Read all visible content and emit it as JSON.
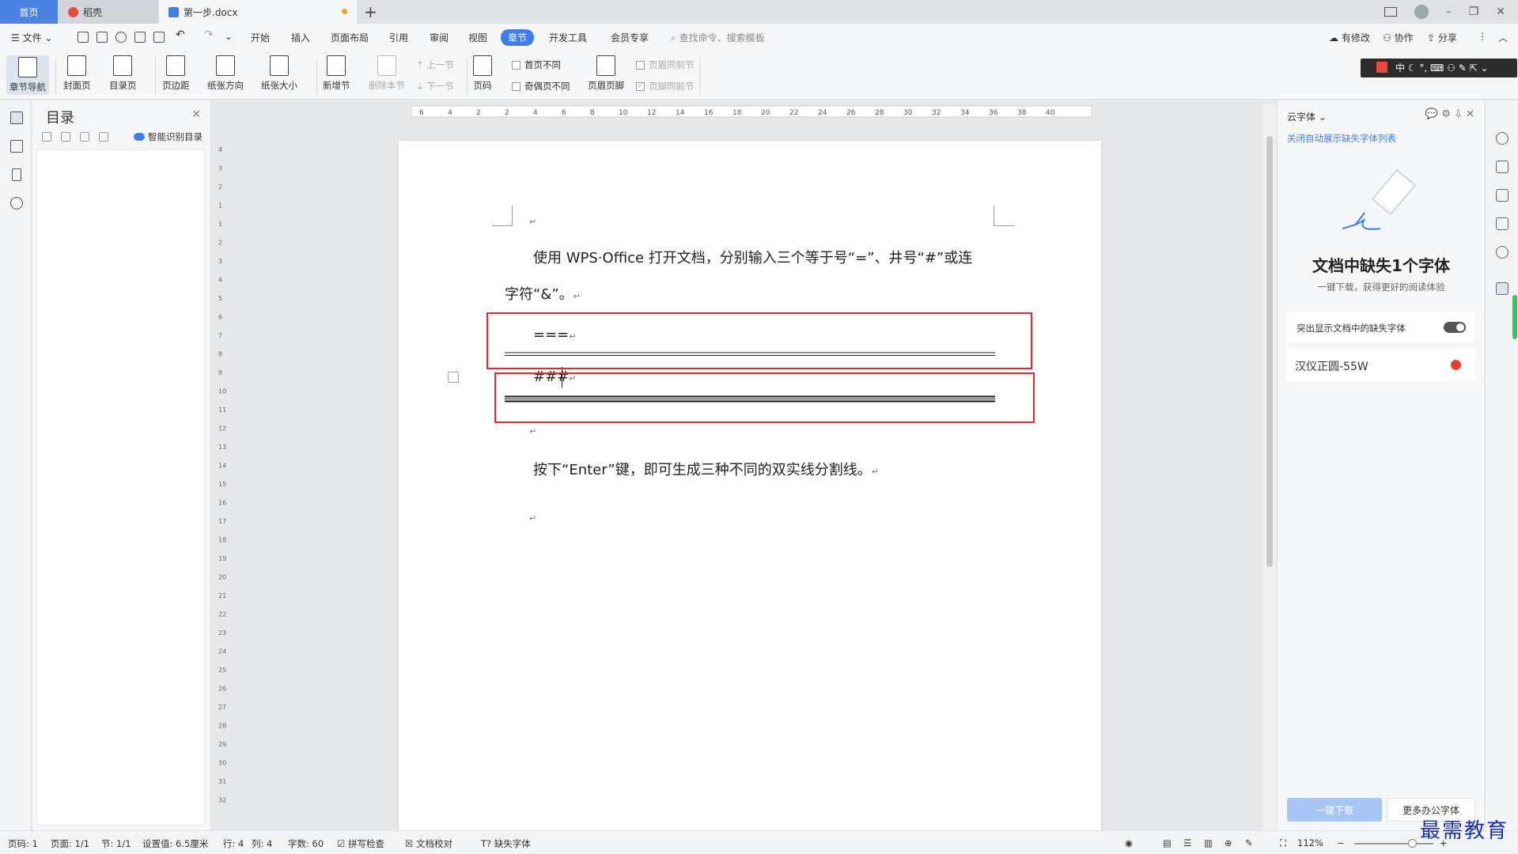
{
  "titlebar": {
    "tabs": [
      {
        "label": "首页"
      },
      {
        "label": "稻壳"
      },
      {
        "label": "第一步.docx"
      }
    ],
    "new_tab": "+"
  },
  "menubar": {
    "file": "文件",
    "items": [
      "开始",
      "插入",
      "页面布局",
      "引用",
      "审阅",
      "视图",
      "章节",
      "开发工具",
      "会员专享"
    ],
    "active": "章节",
    "search_placeholder": "查找命令、搜索模板",
    "right": [
      "有修改",
      "协作",
      "分享"
    ]
  },
  "ribbon": {
    "chapter_nav": "章节导航",
    "cover": "封面页",
    "toc_page": "目录页",
    "margin": "页边距",
    "orientation": "纸张方向",
    "size": "纸张大小",
    "new_section": "新增节",
    "delete_section": "删除本节",
    "prev_section": "上一节",
    "next_section": "下一节",
    "page_number": "页码",
    "first_page_diff": "首页不同",
    "odd_even_diff": "奇偶页不同",
    "header_footer": "页眉页脚",
    "header_same_prev": "页眉同前节",
    "footer_same_prev": "页脚同前节"
  },
  "nav": {
    "title": "目录",
    "smart_toc": "智能识别目录"
  },
  "document": {
    "para1_line1": "使用 WPS·Office 打开文档，分别输入三个等于号“=”、井号“#”或连",
    "para1_line2": "字符“&”。",
    "eq_line": "===",
    "hash_line": "###",
    "para2": "按下“Enter”键，即可生成三种不同的双实线分割线。",
    "para_mark": "↵"
  },
  "ruler": {
    "top_ticks": [
      "6",
      "4",
      "2",
      "2",
      "4",
      "6",
      "8",
      "10",
      "12",
      "14",
      "16",
      "18",
      "20",
      "22",
      "24",
      "26",
      "28",
      "30",
      "32",
      "34",
      "36",
      "38",
      "40"
    ],
    "left_ticks": [
      "4",
      "3",
      "2",
      "1",
      "1",
      "2",
      "3",
      "4",
      "5",
      "6",
      "7",
      "8",
      "9",
      "10",
      "11",
      "12",
      "13",
      "14",
      "15",
      "16",
      "17",
      "18",
      "19",
      "20",
      "21",
      "22",
      "23",
      "24",
      "25",
      "26",
      "27",
      "28",
      "29",
      "30",
      "31",
      "32"
    ]
  },
  "right_panel": {
    "header": "云字体",
    "link": "关闭自动展示缺失字体列表",
    "title": "文档中缺失1个字体",
    "subtitle": "一键下载，获得更好的阅读体验",
    "highlight_label": "突出显示文档中的缺失字体",
    "font_name": "汉仪正圆-55W",
    "download_btn": "一键下载",
    "more_btn": "更多办公字体"
  },
  "statusbar": {
    "page_num": "页码: 1",
    "pages": "页面: 1/1",
    "section": "节: 1/1",
    "setting": "设置值: 6.5厘米",
    "row": "行: 4",
    "col": "列: 4",
    "words": "字数: 60",
    "spell": "拼写检查",
    "proof": "文档校对",
    "missing_font": "缺失字体",
    "zoom": "112%"
  },
  "watermark": "最需教育",
  "colors": {
    "accent": "#3d7ef0",
    "highlight_red": "#e8262f"
  }
}
